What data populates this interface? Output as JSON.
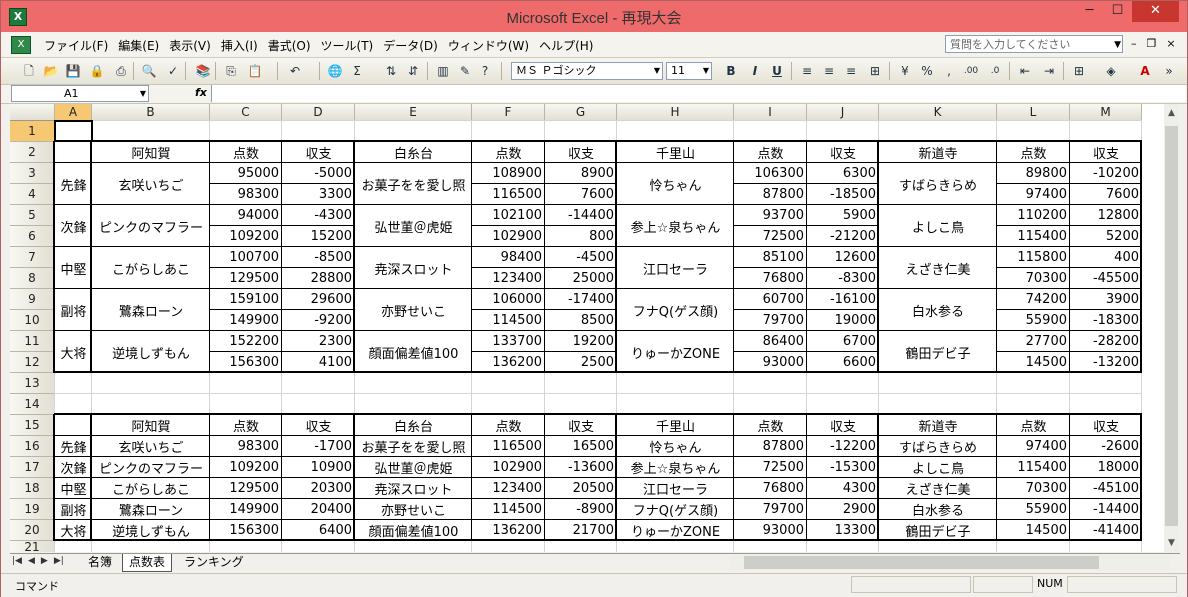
{
  "window": {
    "title": "Microsoft Excel - 再現大会",
    "app_icon": "X"
  },
  "menu": [
    "ファイル(F)",
    "編集(E)",
    "表示(V)",
    "挿入(I)",
    "書式(O)",
    "ツール(T)",
    "データ(D)",
    "ウィンドウ(W)",
    "ヘルプ(H)"
  ],
  "help_placeholder": "質問を入力してください",
  "toolbar": {
    "font": "ＭＳ Ｐゴシック",
    "size": "11"
  },
  "formula": {
    "cell_ref": "A1",
    "fx": "fx",
    "content": ""
  },
  "columns": [
    "A",
    "B",
    "C",
    "D",
    "E",
    "F",
    "G",
    "H",
    "I",
    "J",
    "K",
    "L",
    "M"
  ],
  "rows": [
    "1",
    "2",
    "3",
    "4",
    "5",
    "6",
    "7",
    "8",
    "9",
    "10",
    "11",
    "12",
    "13",
    "14",
    "15",
    "16",
    "17",
    "18",
    "19",
    "20",
    "21"
  ],
  "positions": [
    "先鋒",
    "次鋒",
    "中堅",
    "副将",
    "大将"
  ],
  "schools": [
    "阿知賀",
    "白糸台",
    "千里山",
    "新道寺"
  ],
  "headers": {
    "score": "点数",
    "balance": "収支"
  },
  "players": [
    [
      "玄咲いちご",
      "お菓子をを愛し照",
      "怜ちゃん",
      "すばらきらめ"
    ],
    [
      "ピンクのマフラー",
      "弘世菫＠虎姫",
      "参上☆泉ちゃん",
      "よしこ鳥"
    ],
    [
      "こがらしあこ",
      "尭深スロット",
      "江口セーラ",
      "えざき仁美"
    ],
    [
      "鷺森ローン",
      "亦野せいこ",
      "フナQ(ゲス顔)",
      "白水参る"
    ],
    [
      "逆境しずもん",
      "顔面偏差値100",
      "りゅーかZONE",
      "鶴田デビ子"
    ]
  ],
  "upper": [
    [
      [
        "95000",
        "-5000",
        "108900",
        "8900",
        "106300",
        "6300",
        "89800",
        "-10200"
      ],
      [
        "98300",
        "3300",
        "116500",
        "7600",
        "87800",
        "-18500",
        "97400",
        "7600"
      ]
    ],
    [
      [
        "94000",
        "-4300",
        "102100",
        "-14400",
        "93700",
        "5900",
        "110200",
        "12800"
      ],
      [
        "109200",
        "15200",
        "102900",
        "800",
        "72500",
        "-21200",
        "115400",
        "5200"
      ]
    ],
    [
      [
        "100700",
        "-8500",
        "98400",
        "-4500",
        "85100",
        "12600",
        "115800",
        "400"
      ],
      [
        "129500",
        "28800",
        "123400",
        "25000",
        "76800",
        "-8300",
        "70300",
        "-45500"
      ]
    ],
    [
      [
        "159100",
        "29600",
        "106000",
        "-17400",
        "60700",
        "-16100",
        "74200",
        "3900"
      ],
      [
        "149900",
        "-9200",
        "114500",
        "8500",
        "79700",
        "19000",
        "55900",
        "-18300"
      ]
    ],
    [
      [
        "152200",
        "2300",
        "133700",
        "19200",
        "86400",
        "6700",
        "27700",
        "-28200"
      ],
      [
        "156300",
        "4100",
        "136200",
        "2500",
        "93000",
        "6600",
        "14500",
        "-13200"
      ]
    ]
  ],
  "lower": [
    [
      "98300",
      "-1700",
      "116500",
      "16500",
      "87800",
      "-12200",
      "97400",
      "-2600"
    ],
    [
      "109200",
      "10900",
      "102900",
      "-13600",
      "72500",
      "-15300",
      "115400",
      "18000"
    ],
    [
      "129500",
      "20300",
      "123400",
      "20500",
      "76800",
      "4300",
      "70300",
      "-45100"
    ],
    [
      "149900",
      "20400",
      "114500",
      "-8900",
      "79700",
      "2900",
      "55900",
      "-14400"
    ],
    [
      "156300",
      "6400",
      "136200",
      "21700",
      "93000",
      "13300",
      "14500",
      "-41400"
    ]
  ],
  "tabs": [
    "名簿",
    "点数表",
    "ランキング"
  ],
  "active_tab": "点数表",
  "status": {
    "mode": "コマンド",
    "num": "NUM"
  }
}
